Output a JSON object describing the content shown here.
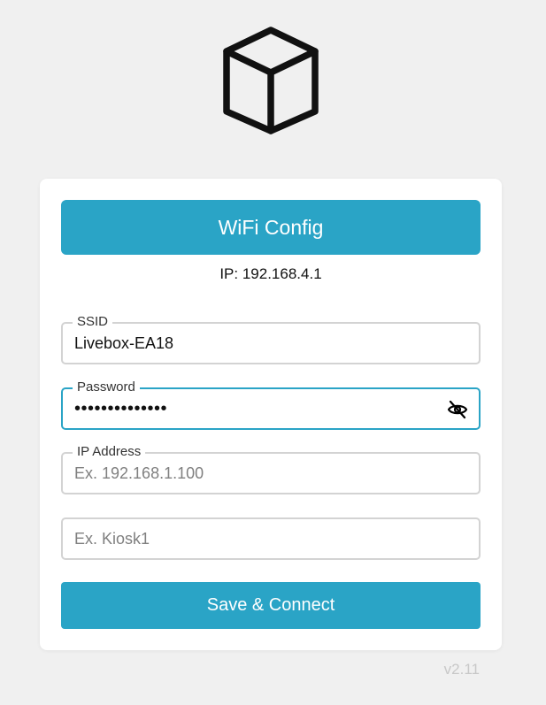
{
  "logo": {
    "icon": "cube-icon"
  },
  "header": {
    "title": "WiFi Config"
  },
  "status": {
    "ip_text": "IP: 192.168.4.1"
  },
  "form": {
    "ssid": {
      "label": "SSID",
      "value": "Livebox-EA18",
      "placeholder": ""
    },
    "password": {
      "label": "Password",
      "value": "••••••••••••••",
      "toggle_icon": "eye-off-icon"
    },
    "ip_address": {
      "label": "IP Address",
      "value": "",
      "placeholder": "Ex. 192.168.1.100"
    },
    "device_name": {
      "value": "",
      "placeholder": "Ex. Kiosk1"
    },
    "submit_label": "Save & Connect"
  },
  "footer": {
    "version": "v2.11"
  },
  "colors": {
    "accent": "#2aa4c6",
    "background": "#f0f0f0",
    "card": "#ffffff",
    "field_border": "#d3d3d3"
  }
}
